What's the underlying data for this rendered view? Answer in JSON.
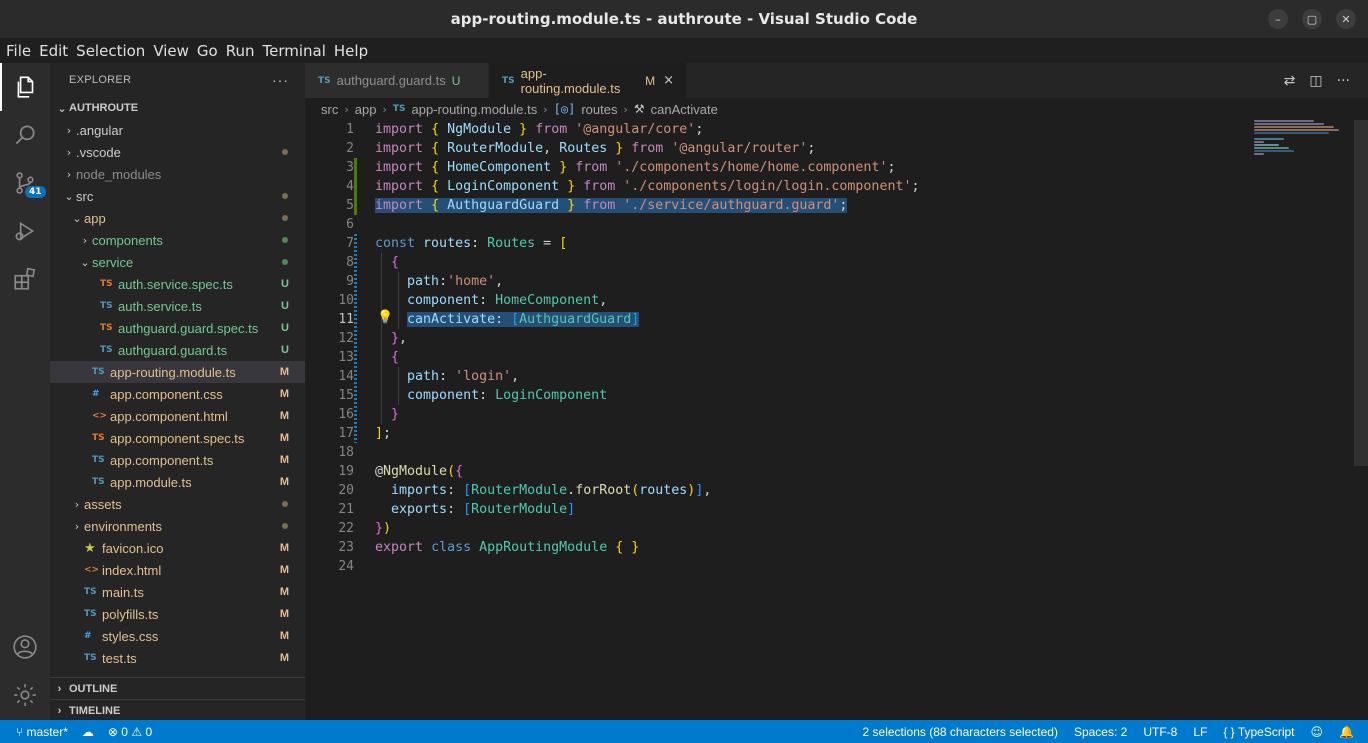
{
  "window": {
    "title": "app-routing.module.ts - authroute - Visual Studio Code",
    "controls": [
      "minimize",
      "maximize",
      "close"
    ]
  },
  "menu": [
    "File",
    "Edit",
    "Selection",
    "View",
    "Go",
    "Run",
    "Terminal",
    "Help"
  ],
  "activity_bar": {
    "items": [
      "explorer-icon",
      "search-icon",
      "source-control-icon",
      "run-debug-icon",
      "extensions-icon",
      "account-icon",
      "gear-icon"
    ],
    "source_control_badge": "41"
  },
  "sidebar": {
    "header": "EXPLORER",
    "more": "···",
    "root": "AUTHROUTE",
    "tree": [
      {
        "label": ".angular",
        "chev": "›",
        "indent": 0,
        "icon": "",
        "status": "",
        "tone": "plain"
      },
      {
        "label": ".vscode",
        "chev": "›",
        "indent": 0,
        "icon": "",
        "status": "dot",
        "tone": "plain"
      },
      {
        "label": "node_modules",
        "chev": "›",
        "indent": 0,
        "icon": "",
        "status": "",
        "tone": "ignored"
      },
      {
        "label": "src",
        "chev": "⌄",
        "indent": 0,
        "icon": "",
        "status": "dot",
        "tone": "plain"
      },
      {
        "label": "app",
        "chev": "⌄",
        "indent": 1,
        "icon": "",
        "status": "dot",
        "tone": "modified"
      },
      {
        "label": "components",
        "chev": "›",
        "indent": 2,
        "icon": "",
        "status": "dotgreen",
        "tone": "untracked"
      },
      {
        "label": "service",
        "chev": "⌄",
        "indent": 2,
        "icon": "",
        "status": "dotgreen",
        "tone": "untracked"
      },
      {
        "label": "auth.service.spec.ts",
        "chev": "",
        "indent": 3,
        "icon": "TS",
        "status": "U",
        "tone": "untracked",
        "spec": true
      },
      {
        "label": "auth.service.ts",
        "chev": "",
        "indent": 3,
        "icon": "TS",
        "status": "U",
        "tone": "untracked",
        "spec": false
      },
      {
        "label": "authguard.guard.spec.ts",
        "chev": "",
        "indent": 3,
        "icon": "TS",
        "status": "U",
        "tone": "untracked",
        "spec": true
      },
      {
        "label": "authguard.guard.ts",
        "chev": "",
        "indent": 3,
        "icon": "TS",
        "status": "U",
        "tone": "untracked",
        "spec": false
      },
      {
        "label": "app-routing.module.ts",
        "chev": "",
        "indent": 2,
        "icon": "TS",
        "status": "M",
        "tone": "modified",
        "selected": true
      },
      {
        "label": "app.component.css",
        "chev": "",
        "indent": 2,
        "icon": "#",
        "status": "M",
        "tone": "modified"
      },
      {
        "label": "app.component.html",
        "chev": "",
        "indent": 2,
        "icon": "<>",
        "status": "M",
        "tone": "modified"
      },
      {
        "label": "app.component.spec.ts",
        "chev": "",
        "indent": 2,
        "icon": "TS",
        "status": "M",
        "tone": "modified",
        "spec": true
      },
      {
        "label": "app.component.ts",
        "chev": "",
        "indent": 2,
        "icon": "TS",
        "status": "M",
        "tone": "modified"
      },
      {
        "label": "app.module.ts",
        "chev": "",
        "indent": 2,
        "icon": "TS",
        "status": "M",
        "tone": "modified"
      },
      {
        "label": "assets",
        "chev": "›",
        "indent": 1,
        "icon": "",
        "status": "dot",
        "tone": "modified"
      },
      {
        "label": "environments",
        "chev": "›",
        "indent": 1,
        "icon": "",
        "status": "dot",
        "tone": "modified"
      },
      {
        "label": "favicon.ico",
        "chev": "",
        "indent": 1,
        "icon": "★",
        "status": "M",
        "tone": "modified"
      },
      {
        "label": "index.html",
        "chev": "",
        "indent": 1,
        "icon": "<>",
        "status": "M",
        "tone": "modified"
      },
      {
        "label": "main.ts",
        "chev": "",
        "indent": 1,
        "icon": "TS",
        "status": "M",
        "tone": "modified"
      },
      {
        "label": "polyfills.ts",
        "chev": "",
        "indent": 1,
        "icon": "TS",
        "status": "M",
        "tone": "modified"
      },
      {
        "label": "styles.css",
        "chev": "",
        "indent": 1,
        "icon": "#",
        "status": "M",
        "tone": "modified"
      },
      {
        "label": "test.ts",
        "chev": "",
        "indent": 1,
        "icon": "TS",
        "status": "M",
        "tone": "modified"
      }
    ],
    "sections": [
      "OUTLINE",
      "TIMELINE"
    ]
  },
  "tabs": [
    {
      "icon": "TS",
      "label": "authguard.guard.ts",
      "status": "U"
    },
    {
      "icon": "TS",
      "label": "app-routing.module.ts",
      "status": "M",
      "close": "×"
    }
  ],
  "breadcrumb": {
    "items": [
      "src",
      "app",
      "app-routing.module.ts",
      "routes",
      "canActivate"
    ],
    "file_icon": "TS",
    "routes_icon": "[◎]",
    "canactivate_icon": "🔧"
  },
  "editor": {
    "current_line": 11,
    "lines": [
      [
        [
          "k1",
          "import"
        ],
        [
          "",
          "",
          " "
        ],
        [
          "br1",
          "{"
        ],
        [
          "",
          " "
        ],
        [
          "vr",
          "NgModule"
        ],
        [
          "",
          " "
        ],
        [
          "br1",
          "}"
        ],
        [
          "",
          " "
        ],
        [
          "k1",
          "from"
        ],
        [
          "",
          " "
        ],
        [
          "st",
          "'@angular/core'"
        ],
        [
          "",
          ";"
        ]
      ],
      [
        [
          "k1",
          "import"
        ],
        [
          "",
          " "
        ],
        [
          "br1",
          "{"
        ],
        [
          "",
          " "
        ],
        [
          "vr",
          "RouterModule"
        ],
        [
          "",
          ", "
        ],
        [
          "vr",
          "Routes"
        ],
        [
          "",
          " "
        ],
        [
          "br1",
          "}"
        ],
        [
          "",
          " "
        ],
        [
          "k1",
          "from"
        ],
        [
          "",
          " "
        ],
        [
          "st",
          "'@angular/router'"
        ],
        [
          "",
          ";"
        ]
      ],
      [
        [
          "k1",
          "import"
        ],
        [
          "",
          " "
        ],
        [
          "br1",
          "{"
        ],
        [
          "",
          " "
        ],
        [
          "vr",
          "HomeComponent"
        ],
        [
          "",
          " "
        ],
        [
          "br1",
          "}"
        ],
        [
          "",
          " "
        ],
        [
          "k1",
          "from"
        ],
        [
          "",
          " "
        ],
        [
          "st",
          "'./components/home/home.component'"
        ],
        [
          "",
          ";"
        ]
      ],
      [
        [
          "k1",
          "import"
        ],
        [
          "",
          " "
        ],
        [
          "br1",
          "{"
        ],
        [
          "",
          " "
        ],
        [
          "vr",
          "LoginComponent"
        ],
        [
          "",
          " "
        ],
        [
          "br1",
          "}"
        ],
        [
          "",
          " "
        ],
        [
          "k1",
          "from"
        ],
        [
          "",
          " "
        ],
        [
          "st",
          "'./components/login/login.component'"
        ],
        [
          "",
          ";"
        ]
      ],
      [
        [
          "k1",
          "import"
        ],
        [
          "",
          " "
        ],
        [
          "br1",
          "{"
        ],
        [
          "",
          " "
        ],
        [
          "vr",
          "AuthguardGuard"
        ],
        [
          "",
          " "
        ],
        [
          "br1",
          "}"
        ],
        [
          "",
          " "
        ],
        [
          "k1",
          "from"
        ],
        [
          "",
          " "
        ],
        [
          "st",
          "'./service/authguard.guard'"
        ],
        [
          "",
          ";"
        ]
      ],
      [],
      [
        [
          "k2",
          "const"
        ],
        [
          "",
          " "
        ],
        [
          "vr",
          "routes"
        ],
        [
          "",
          ": "
        ],
        [
          "ty",
          "Routes"
        ],
        [
          "",
          " = "
        ],
        [
          "br1",
          "["
        ]
      ],
      [
        [
          "",
          "  "
        ],
        [
          "br2",
          "{"
        ]
      ],
      [
        [
          "",
          "    "
        ],
        [
          "vr",
          "path"
        ],
        [
          "",
          ":"
        ],
        [
          "st",
          "'home'"
        ],
        [
          "",
          ","
        ]
      ],
      [
        [
          "",
          "    "
        ],
        [
          "vr",
          "component"
        ],
        [
          "",
          ": "
        ],
        [
          "ty",
          "HomeComponent"
        ],
        [
          "",
          ","
        ]
      ],
      [
        [
          "",
          "    "
        ],
        [
          "vr",
          "canActivate"
        ],
        [
          "",
          ": "
        ],
        [
          "br3",
          "["
        ],
        [
          "ty",
          "AuthguardGuard"
        ],
        [
          "br3",
          "]"
        ]
      ],
      [
        [
          "",
          "  "
        ],
        [
          "br2",
          "}"
        ],
        [
          "",
          ","
        ]
      ],
      [
        [
          "",
          "  "
        ],
        [
          "br2",
          "{"
        ]
      ],
      [
        [
          "",
          "    "
        ],
        [
          "vr",
          "path"
        ],
        [
          "",
          ": "
        ],
        [
          "st",
          "'login'"
        ],
        [
          "",
          ","
        ]
      ],
      [
        [
          "",
          "    "
        ],
        [
          "vr",
          "component"
        ],
        [
          "",
          ": "
        ],
        [
          "ty",
          "LoginComponent"
        ]
      ],
      [
        [
          "",
          "  "
        ],
        [
          "br2",
          "}"
        ]
      ],
      [
        [
          "br1",
          "]"
        ],
        [
          "",
          ";"
        ]
      ],
      [],
      [
        [
          "",
          "@"
        ],
        [
          "fn",
          "NgModule"
        ],
        [
          "br1",
          "("
        ],
        [
          "br2",
          "{"
        ]
      ],
      [
        [
          "",
          "  "
        ],
        [
          "vr",
          "imports"
        ],
        [
          "",
          ": "
        ],
        [
          "br3",
          "["
        ],
        [
          "ty",
          "RouterModule"
        ],
        [
          "",
          "."
        ],
        [
          "fn",
          "forRoot"
        ],
        [
          "br1",
          "("
        ],
        [
          "vr",
          "routes"
        ],
        [
          "br1",
          ")"
        ],
        [
          "br3",
          "]"
        ],
        [
          "",
          ","
        ]
      ],
      [
        [
          "",
          "  "
        ],
        [
          "vr",
          "exports"
        ],
        [
          "",
          ": "
        ],
        [
          "br3",
          "["
        ],
        [
          "ty",
          "RouterModule"
        ],
        [
          "br3",
          "]"
        ]
      ],
      [
        [
          "br2",
          "}"
        ],
        [
          "br1",
          ")"
        ]
      ],
      [
        [
          "k1",
          "export"
        ],
        [
          "",
          " "
        ],
        [
          "k2",
          "class"
        ],
        [
          "",
          " "
        ],
        [
          "ty",
          "AppRoutingModule"
        ],
        [
          "",
          " "
        ],
        [
          "br1",
          "{"
        ],
        [
          "",
          " "
        ],
        [
          "br1",
          "}"
        ]
      ],
      []
    ]
  },
  "statusbar": {
    "branch": "master*",
    "sync_icon": "sync-icon",
    "errors": "0",
    "warnings": "0",
    "selection": "2 selections (88 characters selected)",
    "spaces": "Spaces: 2",
    "encoding": "UTF-8",
    "eol": "LF",
    "language": "TypeScript",
    "language_prefix": "{ }"
  }
}
